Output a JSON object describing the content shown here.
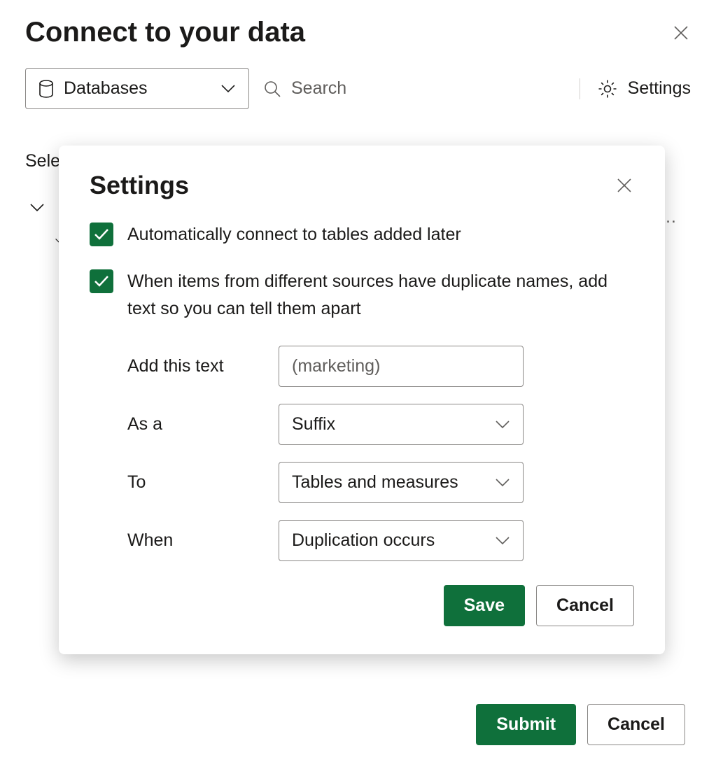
{
  "page": {
    "title": "Connect to your data",
    "databases_label": "Databases",
    "search_placeholder": "Search",
    "settings_label": "Settings",
    "behind_text": "Sele",
    "tree_dots": "…",
    "submit_label": "Submit",
    "cancel_label": "Cancel"
  },
  "modal": {
    "title": "Settings",
    "option_auto_connect": "Automatically connect to tables added later",
    "option_duplicate": "When items from different sources have duplicate names, add text so you can tell them apart",
    "labels": {
      "add_text": "Add this text",
      "as_a": "As a",
      "to": "To",
      "when": "When"
    },
    "values": {
      "add_text": "(marketing)",
      "as_a": "Suffix",
      "to": "Tables and measures",
      "when": "Duplication occurs"
    },
    "save_label": "Save",
    "cancel_label": "Cancel"
  }
}
